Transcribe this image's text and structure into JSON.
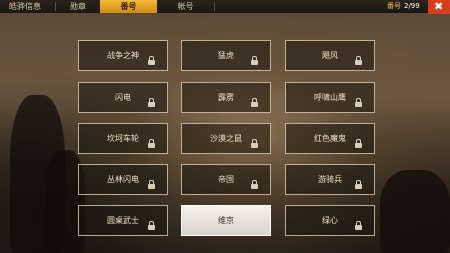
{
  "tabs": [
    {
      "label": "皓骅信息",
      "active": false
    },
    {
      "label": "勋章",
      "active": false
    },
    {
      "label": "番号",
      "active": true
    },
    {
      "label": "帐号",
      "active": false
    }
  ],
  "header": {
    "code_label": "番号",
    "code_value": "2/99",
    "close_icon": "close-icon"
  },
  "titles": [
    {
      "label": "战争之神",
      "locked": true
    },
    {
      "label": "猛虎",
      "locked": true
    },
    {
      "label": "飓风",
      "locked": true
    },
    {
      "label": "闪电",
      "locked": true
    },
    {
      "label": "霹雳",
      "locked": true
    },
    {
      "label": "呼啸山鹰",
      "locked": true
    },
    {
      "label": "坎坷车轮",
      "locked": true
    },
    {
      "label": "沙漠之鼠",
      "locked": true
    },
    {
      "label": "红色魔鬼",
      "locked": true
    },
    {
      "label": "丛林闪电",
      "locked": true
    },
    {
      "label": "帝国",
      "locked": true
    },
    {
      "label": "游骑兵",
      "locked": true
    },
    {
      "label": "圆桌武士",
      "locked": true
    },
    {
      "label": "维京",
      "locked": false,
      "selected": true
    },
    {
      "label": "绿心",
      "locked": true
    }
  ],
  "colors": {
    "accent": "#e9a52a",
    "close": "#d63c1e"
  }
}
